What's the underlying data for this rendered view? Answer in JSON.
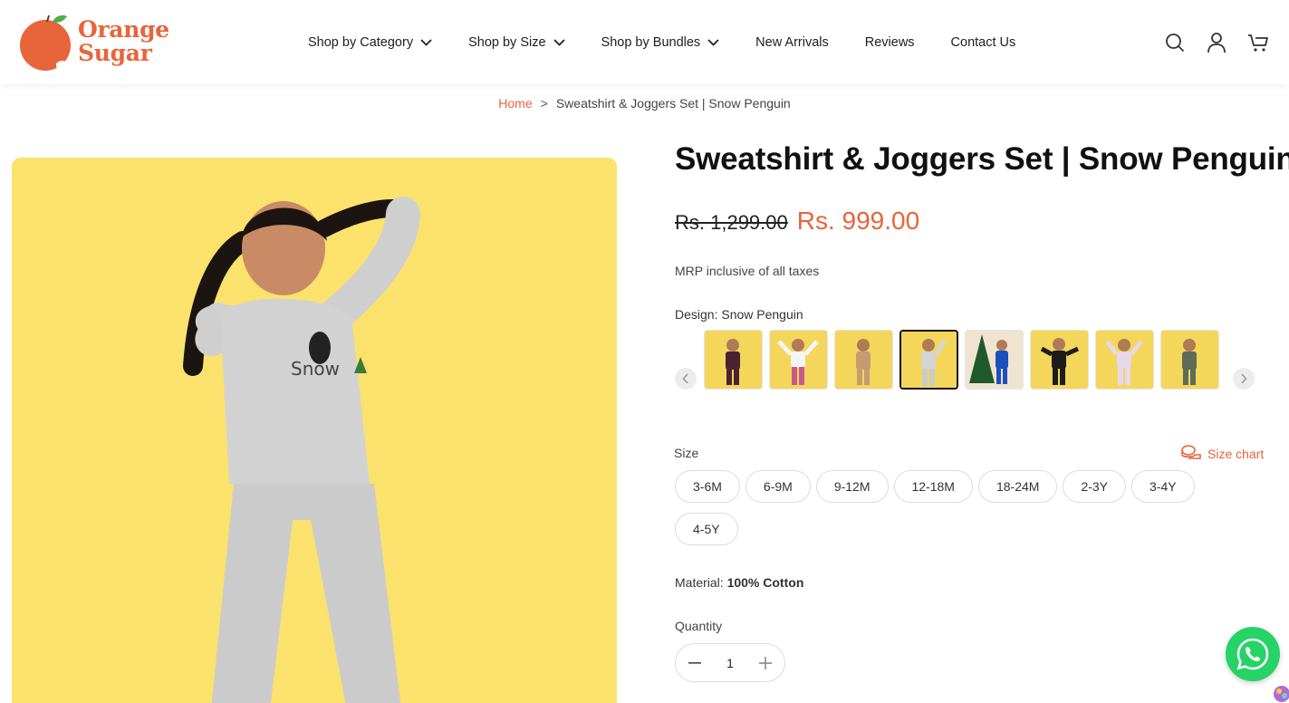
{
  "brand": {
    "name_line1": "Orange",
    "name_line2": "Sugar",
    "color": "#e8643a"
  },
  "nav": {
    "items": [
      {
        "label": "Shop by Category",
        "dropdown": true
      },
      {
        "label": "Shop by Size",
        "dropdown": true
      },
      {
        "label": "Shop by Bundles",
        "dropdown": true
      },
      {
        "label": "New Arrivals",
        "dropdown": false
      },
      {
        "label": "Reviews",
        "dropdown": false
      },
      {
        "label": "Contact Us",
        "dropdown": false
      }
    ],
    "icons": [
      "search-icon",
      "account-icon",
      "cart-icon"
    ]
  },
  "breadcrumb": {
    "home": "Home",
    "separator": ">",
    "current": "Sweatshirt & Joggers Set | Snow Penguin"
  },
  "product": {
    "title": "Sweatshirt & Joggers Set | Snow Penguin",
    "old_price": "Rs. 1,299.00",
    "price": "Rs. 999.00",
    "tax_note": "MRP inclusive of all taxes",
    "design_label": "Design: Snow Penguin",
    "design_thumbnails_count": 8,
    "active_design_index": 3,
    "size_label": "Size",
    "size_chart_label": "Size chart",
    "sizes": [
      "3-6M",
      "6-9M",
      "9-12M",
      "12-18M",
      "18-24M",
      "2-3Y",
      "3-4Y",
      "4-5Y"
    ],
    "material_label": "Material:",
    "material_value": "100% Cotton",
    "quantity_label": "Quantity",
    "quantity_value": "1"
  },
  "colors": {
    "accent": "#e8643a",
    "image_bg": "#fbe26c",
    "whatsapp": "#25d366"
  }
}
